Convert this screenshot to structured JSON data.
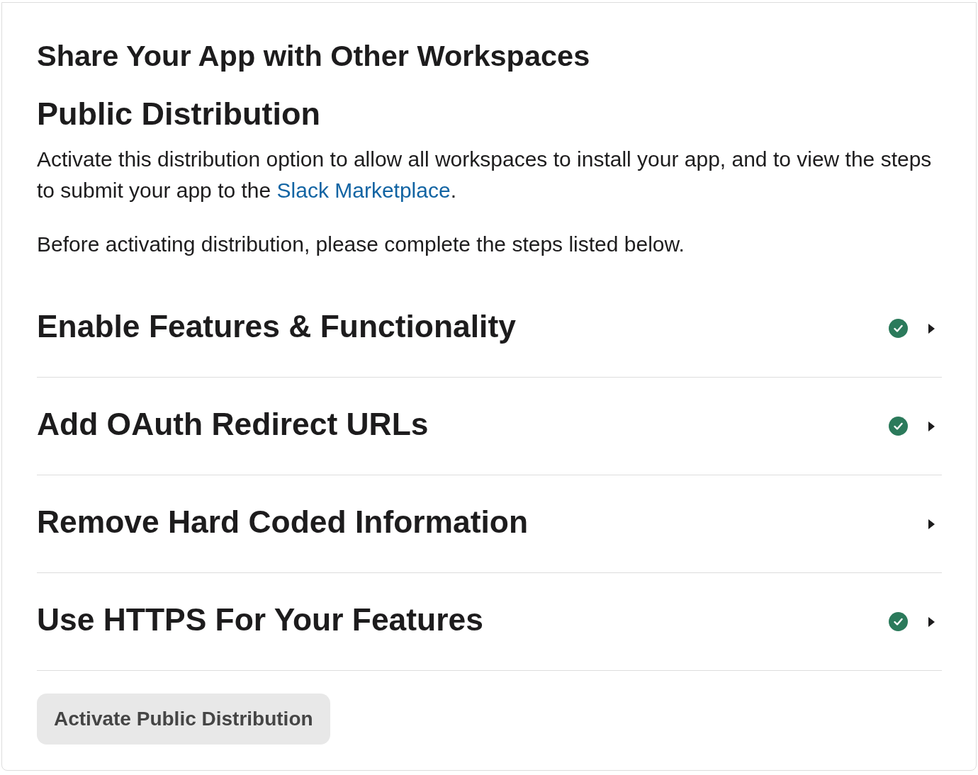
{
  "section": {
    "title": "Share Your App with Other Workspaces"
  },
  "distribution": {
    "heading": "Public Distribution",
    "description_before": "Activate this distribution option to allow all workspaces to install your app, and to view the steps to submit your app to the ",
    "link": "Slack Marketplace",
    "description_after": ".",
    "note": "Before activating distribution, please complete the steps listed below."
  },
  "steps": [
    {
      "title": "Enable Features & Functionality",
      "completed": true,
      "expanded": false
    },
    {
      "title": "Add OAuth Redirect URLs",
      "completed": true,
      "expanded": false
    },
    {
      "title": "Remove Hard Coded Information",
      "completed": false,
      "expanded": false
    },
    {
      "title": "Use HTTPS For Your Features",
      "completed": true,
      "expanded": false
    }
  ],
  "button": {
    "label": "Activate Public Distribution",
    "disabled": true
  }
}
